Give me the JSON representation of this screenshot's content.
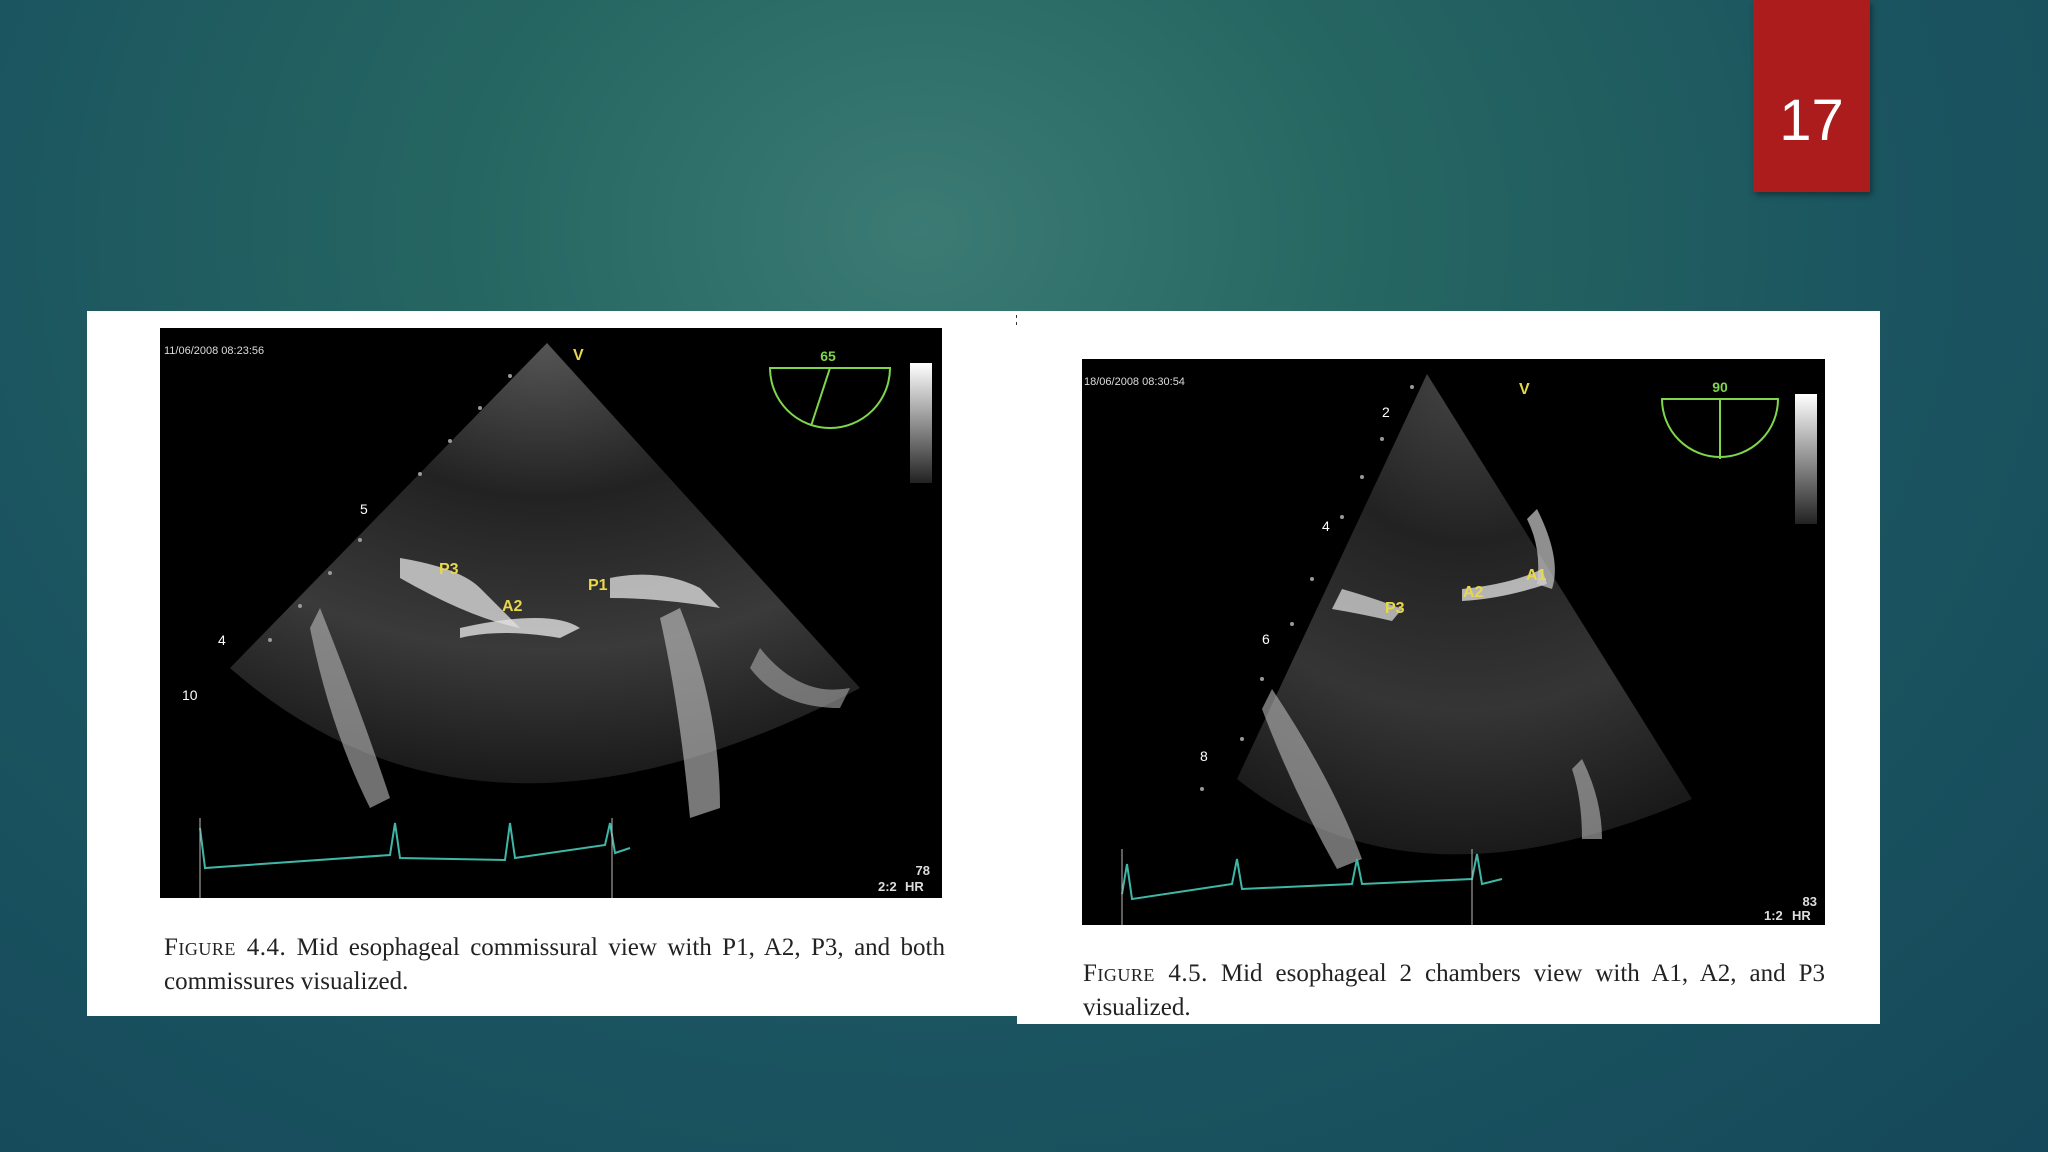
{
  "slide": {
    "number": "17"
  },
  "figure_left": {
    "timestamp": "11/06/2008 08:23:56",
    "sector_angle": "65",
    "probe_marker": "V",
    "depth_marks": [
      "5",
      "4",
      "10"
    ],
    "labels": [
      "P3",
      "A2",
      "P1"
    ],
    "frame_rate": "2:2",
    "heart_rate": "78",
    "hr_label": "HR",
    "caption_label": "Figure 4.4.",
    "caption_text": " Mid esophageal commissural view with P1, A2, P3, and both commissures visualized."
  },
  "figure_right": {
    "timestamp": "18/06/2008 08:30:54",
    "sector_angle": "90",
    "probe_marker": "V",
    "depth_marks": [
      "2",
      "4",
      "6",
      "8"
    ],
    "labels": [
      "P3",
      "A2",
      "A1"
    ],
    "frame_rate": "1:2",
    "heart_rate": "83",
    "hr_label": "HR",
    "caption_label": "Figure 4.5.",
    "caption_text": " Mid esophageal 2 chambers view with A1, A2, and P3 visualized."
  },
  "colors": {
    "label_yellow": "#e8d84a",
    "angle_green": "#7fd64a",
    "ecg_teal": "#3fb7a6",
    "slide_number_bg": "#ad1c1c"
  }
}
